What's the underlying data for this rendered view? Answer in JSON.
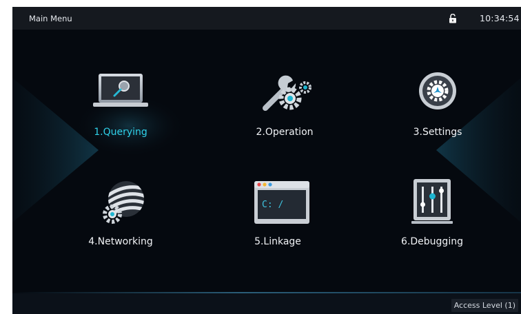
{
  "header": {
    "title": "Main Menu",
    "lock_icon": "unlocked-padlock-icon",
    "time": "10:34:54"
  },
  "menu": {
    "items": [
      {
        "label": "1.Querying",
        "icon": "laptop-magnifier-icon",
        "active": true
      },
      {
        "label": "2.Operation",
        "icon": "wrench-gears-icon",
        "active": false
      },
      {
        "label": "3.Settings",
        "icon": "settings-gear-icon",
        "active": false
      },
      {
        "label": "4.Networking",
        "icon": "network-globe-icon",
        "active": false
      },
      {
        "label": "5.Linkage",
        "icon": "terminal-window-icon",
        "active": false
      },
      {
        "label": "6.Debugging",
        "icon": "slider-controls-icon",
        "active": false
      }
    ]
  },
  "footer": {
    "access_level": "Access Level  (1)"
  },
  "colors": {
    "background": "#05090f",
    "header": "#15191f",
    "active_label": "#2fd0e8",
    "label": "#f1f3f6"
  }
}
